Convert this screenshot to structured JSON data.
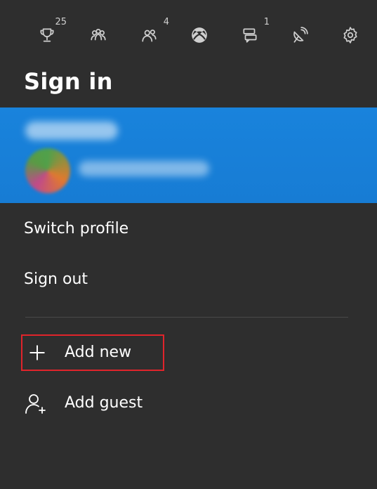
{
  "topbar": {
    "items": [
      {
        "icon": "trophy-icon",
        "badge": "25"
      },
      {
        "icon": "friends-icon",
        "badge": ""
      },
      {
        "icon": "party-icon",
        "badge": "4"
      },
      {
        "icon": "xbox-icon",
        "badge": ""
      },
      {
        "icon": "messages-icon",
        "badge": "1"
      },
      {
        "icon": "broadcast-icon",
        "badge": ""
      },
      {
        "icon": "settings-icon",
        "badge": ""
      }
    ]
  },
  "title": "Sign in",
  "menu": {
    "switch_profile": "Switch profile",
    "sign_out": "Sign out",
    "add_new": "Add new",
    "add_guest": "Add guest"
  },
  "colors": {
    "background": "#2e2e2e",
    "profile_card": "#177cd4",
    "highlight_box": "#e0242b"
  }
}
